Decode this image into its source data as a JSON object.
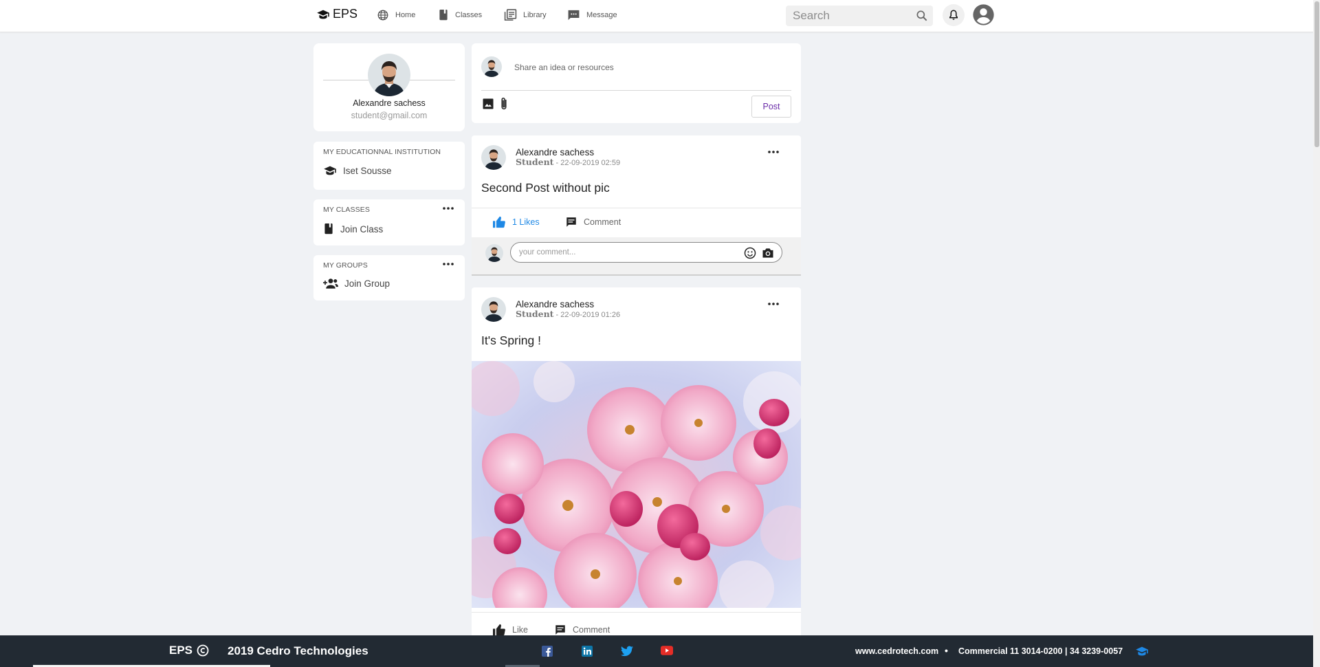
{
  "navbar": {
    "brand": "EPS",
    "items": [
      {
        "label": "Home",
        "icon": "globe-icon"
      },
      {
        "label": "Classes",
        "icon": "book-icon"
      },
      {
        "label": "Library",
        "icon": "library-icon"
      },
      {
        "label": "Message",
        "icon": "message-icon"
      }
    ],
    "search_placeholder": "Search"
  },
  "profile": {
    "name": "Alexandre sachess",
    "email": "student@gmail.com"
  },
  "sidebar": {
    "institution": {
      "title": "MY EDUCATIONNAL INSTITUTION",
      "item": "Iset Sousse"
    },
    "classes": {
      "title": "MY CLASSES",
      "item": "Join Class"
    },
    "groups": {
      "title": "MY GROUPS",
      "item": "Join Group"
    }
  },
  "composer": {
    "placeholder": "Share an idea or resources",
    "post_label": "Post"
  },
  "posts": [
    {
      "author": "Alexandre sachess",
      "role": "Student",
      "date": "- 22-09-2019 02:59",
      "text": "Second Post without pic",
      "like_label": "1 Likes",
      "comment_label": "Comment",
      "comment_placeholder": "your comment..."
    },
    {
      "author": "Alexandre sachess",
      "role": "Student",
      "date": "- 22-09-2019 01:26",
      "text": "It's Spring !",
      "like_label": "Like",
      "comment_label": "Comment"
    }
  ],
  "footer": {
    "brand": "EPS",
    "company": "2019 Cedro Technologies",
    "website": "www.cedrotech.com",
    "separator": "•",
    "contact": "Commercial 11 3014-0200 | 34 3239-0057",
    "socials": [
      "facebook-icon",
      "linkedin-icon",
      "twitter-icon",
      "youtube-icon"
    ]
  },
  "colors": {
    "background": "#f0f2f5",
    "accent_like": "#1e88e5",
    "post_button_text": "#6a2ca8",
    "footer": "#222a33",
    "facebook": "#3b5998",
    "linkedin": "#0e76a8",
    "twitter": "#1da1f2",
    "youtube": "#e52d27"
  }
}
